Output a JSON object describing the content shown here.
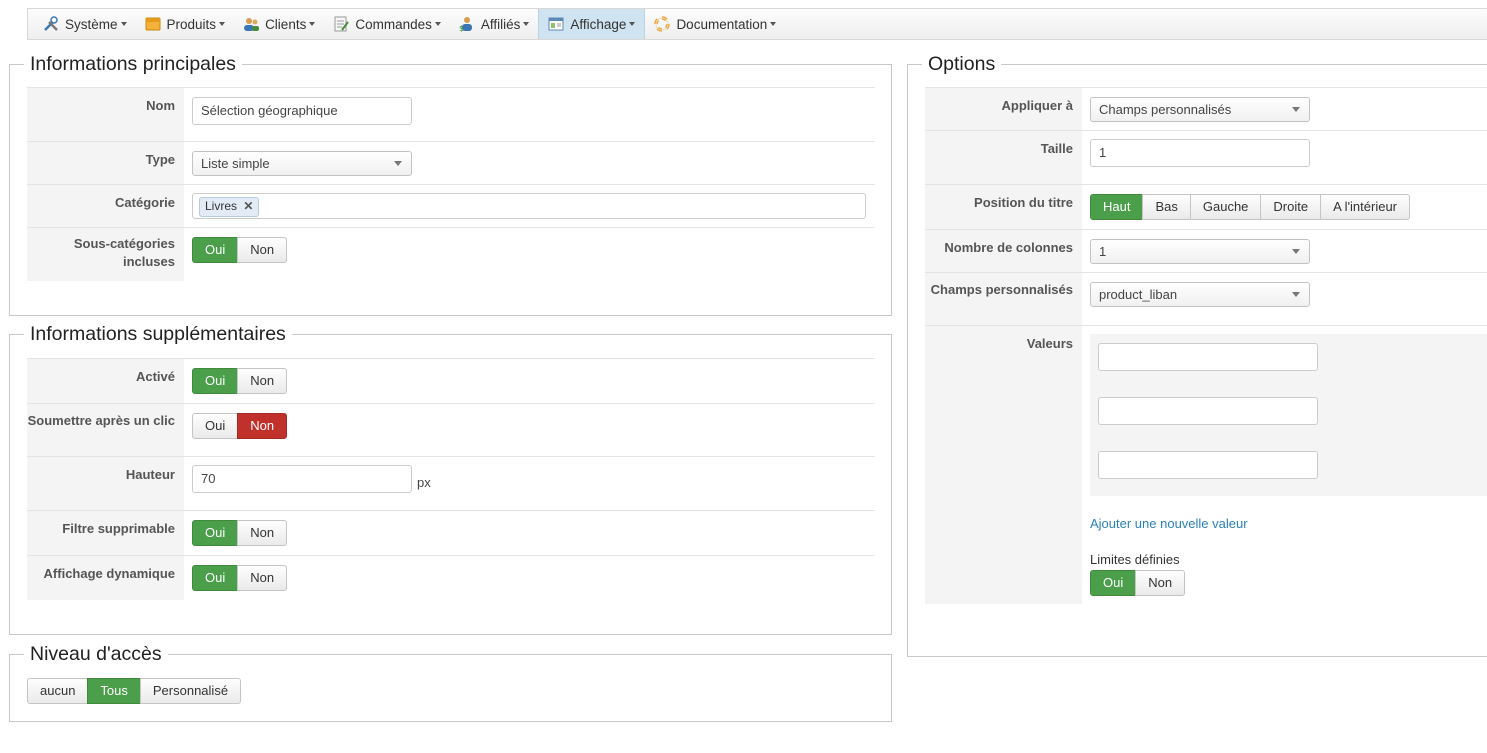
{
  "menu": [
    {
      "label": "Système",
      "icon": "tools-icon"
    },
    {
      "label": "Produits",
      "icon": "box-icon"
    },
    {
      "label": "Clients",
      "icon": "users-icon"
    },
    {
      "label": "Commandes",
      "icon": "orders-icon"
    },
    {
      "label": "Affiliés",
      "icon": "affiliates-icon"
    },
    {
      "label": "Affichage",
      "icon": "display-icon"
    },
    {
      "label": "Documentation",
      "icon": "lifebuoy-icon"
    }
  ],
  "main": {
    "legend": "Informations principales",
    "nom": {
      "label": "Nom",
      "value": "Sélection géographique"
    },
    "type": {
      "label": "Type",
      "value": "Liste simple"
    },
    "categorie": {
      "label": "Catégorie",
      "tag": "Livres"
    },
    "souscat": {
      "label": "Sous-catégories incluses",
      "oui": "Oui",
      "non": "Non"
    }
  },
  "extra": {
    "legend": "Informations supplémentaires",
    "active": {
      "label": "Activé",
      "oui": "Oui",
      "non": "Non"
    },
    "soumettre": {
      "label": "Soumettre après un clic",
      "oui": "Oui",
      "non": "Non"
    },
    "hauteur": {
      "label": "Hauteur",
      "value": "70",
      "unit": "px"
    },
    "filtre": {
      "label": "Filtre supprimable",
      "oui": "Oui",
      "non": "Non"
    },
    "dyn": {
      "label": "Affichage dynamique",
      "oui": "Oui",
      "non": "Non"
    }
  },
  "access": {
    "legend": "Niveau d'accès",
    "aucun": "aucun",
    "tous": "Tous",
    "perso": "Personnalisé"
  },
  "options": {
    "legend": "Options",
    "appliquer": {
      "label": "Appliquer à",
      "value": "Champs personnalisés"
    },
    "taille": {
      "label": "Taille",
      "value": "1"
    },
    "position": {
      "label": "Position du titre",
      "haut": "Haut",
      "bas": "Bas",
      "gauche": "Gauche",
      "droite": "Droite",
      "interieur": "A l'intérieur"
    },
    "colonnes": {
      "label": "Nombre de colonnes",
      "value": "1"
    },
    "champs": {
      "label": "Champs personnalisés",
      "value": "product_liban"
    },
    "valeurs": {
      "label": "Valeurs",
      "add": "Ajouter une nouvelle valeur",
      "limites": "Limites définies",
      "oui": "Oui",
      "non": "Non"
    }
  },
  "colors": {
    "accent_green": "#4c9f4a",
    "accent_red": "#c0312b",
    "link": "#2a82b8",
    "menu_active": "#cfe3f1"
  }
}
